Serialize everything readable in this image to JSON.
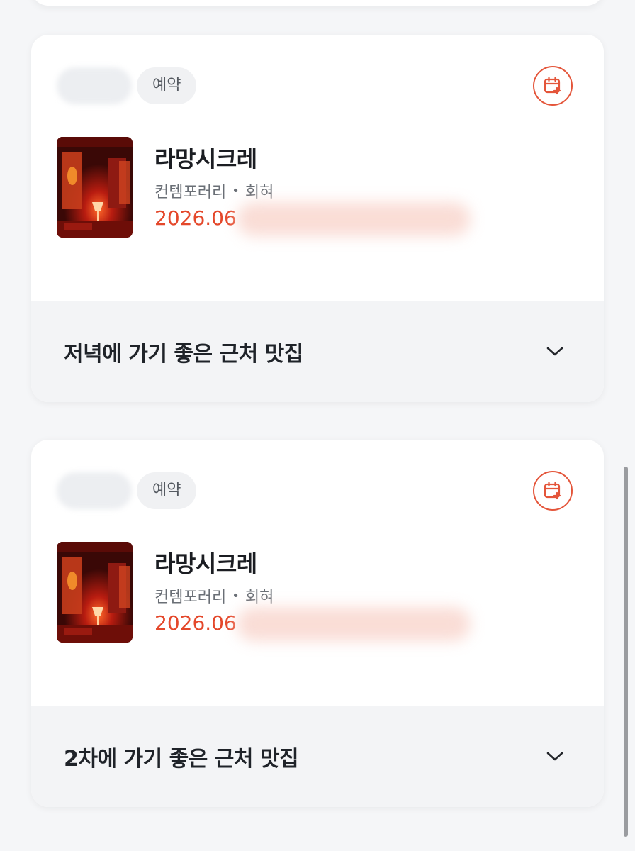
{
  "cards": [
    {
      "status_chip": "예약",
      "title": "라망시크레",
      "genre": "컨템포러리",
      "separator": "•",
      "menu_type": "회혀",
      "date": "2026.06",
      "recommendation_label": "저녁에 가기 좋은 근처 맛집",
      "calendar_icon": "calendar-add-icon",
      "expand_icon": "chevron-down-icon"
    },
    {
      "status_chip": "예약",
      "title": "라망시크레",
      "genre": "컨템포러리",
      "separator": "•",
      "menu_type": "회혀",
      "date": "2026.06",
      "recommendation_label": "2차에 가기 좋은 근처 맛집",
      "calendar_icon": "calendar-add-icon",
      "expand_icon": "chevron-down-icon"
    }
  ],
  "colors": {
    "accent": "#e4482b",
    "card_bg": "#ffffff",
    "section_bg": "#f3f4f6",
    "page_bg": "#f5f6f8"
  }
}
